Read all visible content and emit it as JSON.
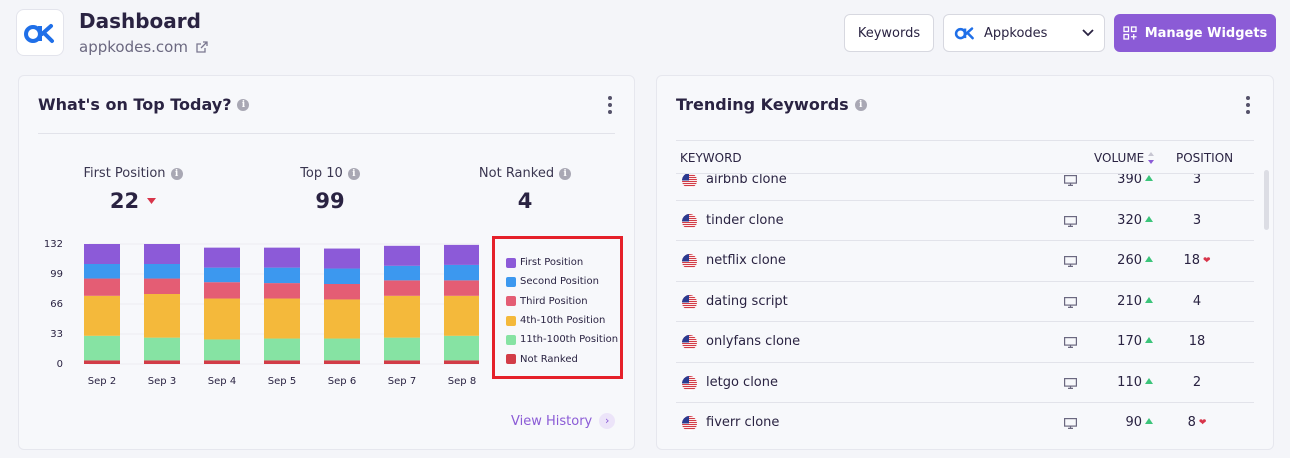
{
  "header": {
    "title": "Dashboard",
    "site": "appkodes.com",
    "keywords_button": "Keywords",
    "app_select": "Appkodes",
    "manage_button": "Manage Widgets"
  },
  "top_today": {
    "title": "What's on Top Today?",
    "stats": [
      {
        "label": "First Position",
        "value": "22"
      },
      {
        "label": "Top 10",
        "value": "99"
      },
      {
        "label": "Not Ranked",
        "value": "4"
      }
    ],
    "view_history": "View History"
  },
  "chart_data": {
    "type": "bar",
    "stacked": true,
    "categories": [
      "Sep 2",
      "Sep 3",
      "Sep 4",
      "Sep 5",
      "Sep 6",
      "Sep 7",
      "Sep 8"
    ],
    "yticks": [
      0,
      33,
      66,
      99,
      132
    ],
    "ylim": [
      0,
      132
    ],
    "legend_position": "right",
    "series": [
      {
        "name": "Not Ranked",
        "color": "#d23c47",
        "values": [
          4,
          4,
          4,
          4,
          4,
          4,
          4
        ]
      },
      {
        "name": "11th-100th Position",
        "color": "#86e3a3",
        "values": [
          27,
          25,
          23,
          24,
          24,
          25,
          27
        ]
      },
      {
        "name": "4th-10th Position",
        "color": "#f4b93b",
        "values": [
          44,
          48,
          45,
          44,
          43,
          46,
          44
        ]
      },
      {
        "name": "Third Position",
        "color": "#e45d74",
        "values": [
          19,
          17,
          18,
          17,
          17,
          17,
          17
        ]
      },
      {
        "name": "Second Position",
        "color": "#3c98ef",
        "values": [
          16,
          16,
          16,
          17,
          17,
          16,
          17
        ]
      },
      {
        "name": "First Position",
        "color": "#8c5ad8",
        "values": [
          22,
          22,
          22,
          22,
          22,
          22,
          22
        ]
      }
    ]
  },
  "legend": [
    {
      "name": "First Position",
      "color": "#8c5ad8"
    },
    {
      "name": "Second Position",
      "color": "#3c98ef"
    },
    {
      "name": "Third Position",
      "color": "#e45d74"
    },
    {
      "name": "4th-10th Position",
      "color": "#f4b93b"
    },
    {
      "name": "11th-100th Position",
      "color": "#86e3a3"
    },
    {
      "name": "Not Ranked",
      "color": "#d23c47"
    }
  ],
  "trending": {
    "title": "Trending Keywords",
    "columns": {
      "keyword": "KEYWORD",
      "volume": "VOLUME",
      "position": "POSITION"
    },
    "rows": [
      {
        "keyword": "airbnb clone",
        "volume": "390",
        "position": "3",
        "trend": "up",
        "pos_heart": false
      },
      {
        "keyword": "tinder clone",
        "volume": "320",
        "position": "3",
        "trend": "up",
        "pos_heart": false
      },
      {
        "keyword": "netflix clone",
        "volume": "260",
        "position": "18",
        "trend": "up",
        "pos_heart": true
      },
      {
        "keyword": "dating script",
        "volume": "210",
        "position": "4",
        "trend": "up",
        "pos_heart": false
      },
      {
        "keyword": "onlyfans clone",
        "volume": "170",
        "position": "18",
        "trend": "up",
        "pos_heart": false
      },
      {
        "keyword": "letgo clone",
        "volume": "110",
        "position": "2",
        "trend": "up",
        "pos_heart": false
      },
      {
        "keyword": "fiverr clone",
        "volume": "90",
        "position": "8",
        "trend": "up",
        "pos_heart": true
      }
    ]
  }
}
